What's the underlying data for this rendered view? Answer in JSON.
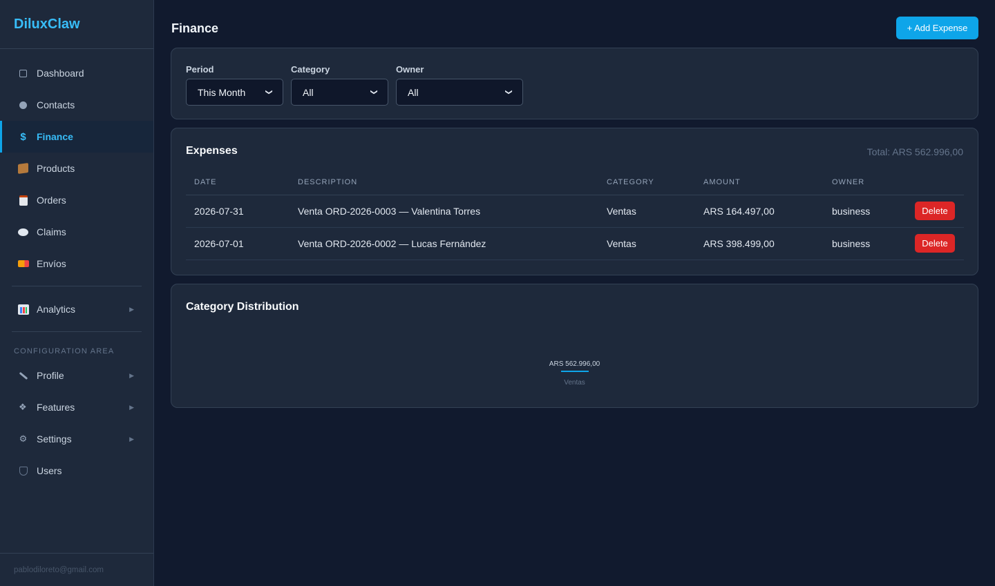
{
  "app": {
    "brand": "DiluxClaw",
    "user_email": "pablodiloreto@gmail.com"
  },
  "sidebar": {
    "items": [
      {
        "label": "Dashboard",
        "icon": "dashboard-icon"
      },
      {
        "label": "Contacts",
        "icon": "contacts-icon"
      },
      {
        "label": "Finance",
        "icon": "dollar-icon",
        "active": true
      },
      {
        "label": "Products",
        "icon": "package-icon"
      },
      {
        "label": "Orders",
        "icon": "clipboard-icon"
      },
      {
        "label": "Claims",
        "icon": "speech-bubble-icon"
      },
      {
        "label": "Envíos",
        "icon": "truck-icon"
      }
    ],
    "analytics": {
      "label": "Analytics",
      "icon": "bar-chart-icon"
    },
    "config_section_label": "CONFIGURATION AREA",
    "config_items": [
      {
        "label": "Profile",
        "icon": "pencil-icon",
        "expandable": true
      },
      {
        "label": "Features",
        "icon": "features-icon",
        "expandable": true
      },
      {
        "label": "Settings",
        "icon": "gear-icon",
        "expandable": true
      },
      {
        "label": "Users",
        "icon": "shield-icon",
        "expandable": false
      }
    ]
  },
  "header": {
    "title": "Finance",
    "add_button": "+ Add Expense"
  },
  "filters": {
    "period": {
      "label": "Period",
      "value": "This Month"
    },
    "category": {
      "label": "Category",
      "value": "All"
    },
    "owner": {
      "label": "Owner",
      "value": "All"
    }
  },
  "expenses": {
    "title": "Expenses",
    "total": "Total: ARS 562.996,00",
    "columns": [
      "DATE",
      "DESCRIPTION",
      "CATEGORY",
      "AMOUNT",
      "OWNER"
    ],
    "rows": [
      {
        "date": "2026-07-31",
        "description": "Venta ORD-2026-0003 — Valentina Torres",
        "category": "Ventas",
        "amount": "ARS 164.497,00",
        "owner": "business"
      },
      {
        "date": "2026-07-01",
        "description": "Venta ORD-2026-0002 — Lucas Fernández",
        "category": "Ventas",
        "amount": "ARS 398.499,00",
        "owner": "business"
      }
    ],
    "delete_label": "Delete"
  },
  "distribution": {
    "title": "Category Distribution",
    "items": [
      {
        "category": "Ventas",
        "value_label": "ARS 562.996,00",
        "share": 1.0
      }
    ]
  },
  "colors": {
    "accent": "#0ea5e9",
    "danger": "#dc2626",
    "background": "#111a2e",
    "card": "#1e293b"
  }
}
